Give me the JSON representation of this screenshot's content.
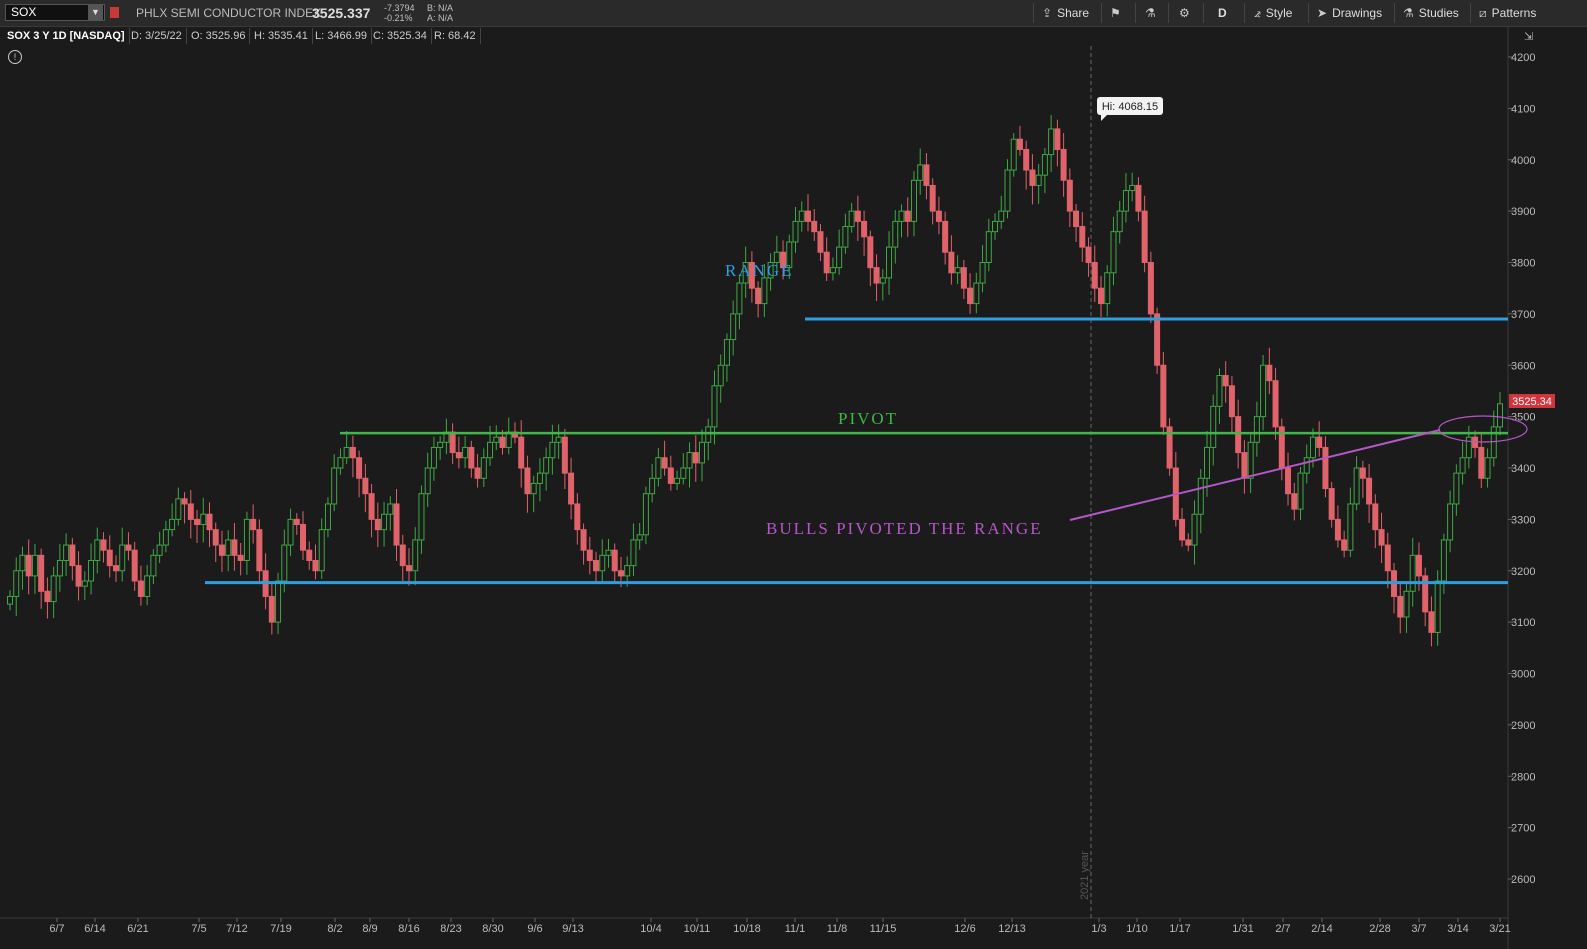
{
  "toolbar": {
    "symbol": "SOX",
    "symbol_arrow": "▼",
    "index_name": "PHLX SEMI CONDUCTOR INDEX",
    "last_price": "3525.337",
    "net_change": "-7.3794",
    "pct_change": "-0.21%",
    "bid": "B: N/A",
    "ask": "A: N/A",
    "share_label": "Share",
    "aggregation_label": "D",
    "style_label": "Style",
    "drawings_label": "Drawings",
    "studies_label": "Studies",
    "patterns_label": "Patterns"
  },
  "info_bar": {
    "symbol": "SOX 3 Y 1D [NASDAQ]",
    "date": "D: 3/25/22",
    "open": "O: 3525.96",
    "high": "H: 3535.41",
    "low": "L: 3466.99",
    "close": "C: 3525.34",
    "range": "R: 68.42",
    "info_icon": "!"
  },
  "chart_data": {
    "type": "candlestick",
    "y_ticks": [
      "4200",
      "4100",
      "4000",
      "3900",
      "3800",
      "3700",
      "3600",
      "3500",
      "3400",
      "3300",
      "3200",
      "3100",
      "3000",
      "2900",
      "2800",
      "2700",
      "2600"
    ],
    "ylim": [
      2530,
      4290
    ],
    "x_ticks": [
      "6/7",
      "6/14",
      "6/21",
      "7/5",
      "7/12",
      "7/19",
      "8/2",
      "8/9",
      "8/16",
      "8/23",
      "8/30",
      "9/6",
      "9/13",
      "10/4",
      "10/11",
      "10/18",
      "11/1",
      "11/8",
      "11/15",
      "12/6",
      "12/13",
      "1/3",
      "1/10",
      "1/17",
      "1/31",
      "2/7",
      "2/14",
      "2/28",
      "3/7",
      "3/14",
      "3/21"
    ],
    "last_price_label": "3525.34",
    "high_label": "Hi: 4068.15",
    "year_marker": "2021 year",
    "annotations": {
      "range": "RANGE",
      "pivot": "PIVOT",
      "bulls": "BULLS PIVOTED THE RANGE"
    },
    "levels": {
      "range_high": 3690,
      "pivot": 3468,
      "range_low": 3177
    },
    "colors": {
      "up": "#3fa845",
      "down": "#e0626a",
      "range_line": "#2d9fe0",
      "pivot_line": "#3fb848",
      "trend_line": "#b557c8",
      "last_price": "#d0343c"
    },
    "closes": [
      3150,
      3200,
      3230,
      3190,
      3230,
      3160,
      3140,
      3190,
      3220,
      3250,
      3210,
      3170,
      3180,
      3220,
      3260,
      3240,
      3210,
      3200,
      3250,
      3240,
      3180,
      3150,
      3190,
      3230,
      3250,
      3280,
      3300,
      3340,
      3330,
      3300,
      3290,
      3310,
      3280,
      3250,
      3230,
      3260,
      3230,
      3220,
      3300,
      3280,
      3200,
      3150,
      3100,
      3180,
      3250,
      3300,
      3290,
      3240,
      3220,
      3200,
      3280,
      3330,
      3400,
      3420,
      3440,
      3420,
      3380,
      3350,
      3300,
      3280,
      3310,
      3330,
      3250,
      3210,
      3200,
      3260,
      3350,
      3400,
      3440,
      3450,
      3470,
      3430,
      3420,
      3440,
      3400,
      3380,
      3420,
      3450,
      3460,
      3440,
      3470,
      3460,
      3400,
      3350,
      3370,
      3390,
      3420,
      3450,
      3460,
      3390,
      3330,
      3280,
      3240,
      3220,
      3200,
      3230,
      3240,
      3200,
      3190,
      3210,
      3260,
      3270,
      3350,
      3380,
      3420,
      3400,
      3370,
      3380,
      3400,
      3430,
      3410,
      3450,
      3480,
      3560,
      3600,
      3650,
      3700,
      3760,
      3800,
      3750,
      3720,
      3770,
      3800,
      3820,
      3790,
      3840,
      3880,
      3900,
      3880,
      3860,
      3820,
      3780,
      3790,
      3830,
      3870,
      3900,
      3880,
      3850,
      3790,
      3760,
      3770,
      3830,
      3880,
      3900,
      3880,
      3960,
      3990,
      3950,
      3900,
      3880,
      3820,
      3780,
      3790,
      3750,
      3720,
      3760,
      3800,
      3860,
      3880,
      3900,
      3980,
      4040,
      4020,
      3980,
      3950,
      3970,
      4010,
      4060,
      4020,
      3960,
      3900,
      3870,
      3830,
      3800,
      3750,
      3720,
      3780,
      3860,
      3900,
      3940,
      3950,
      3900,
      3800,
      3700,
      3600,
      3480,
      3400,
      3300,
      3260,
      3250,
      3310,
      3380,
      3440,
      3520,
      3580,
      3560,
      3500,
      3430,
      3380,
      3450,
      3500,
      3600,
      3570,
      3480,
      3400,
      3350,
      3320,
      3390,
      3420,
      3460,
      3440,
      3360,
      3300,
      3260,
      3240,
      3330,
      3400,
      3380,
      3330,
      3280,
      3250,
      3200,
      3150,
      3110,
      3160,
      3230,
      3190,
      3120,
      3080,
      3180,
      3260,
      3330,
      3390,
      3420,
      3460,
      3440,
      3380,
      3420,
      3480,
      3525
    ]
  }
}
